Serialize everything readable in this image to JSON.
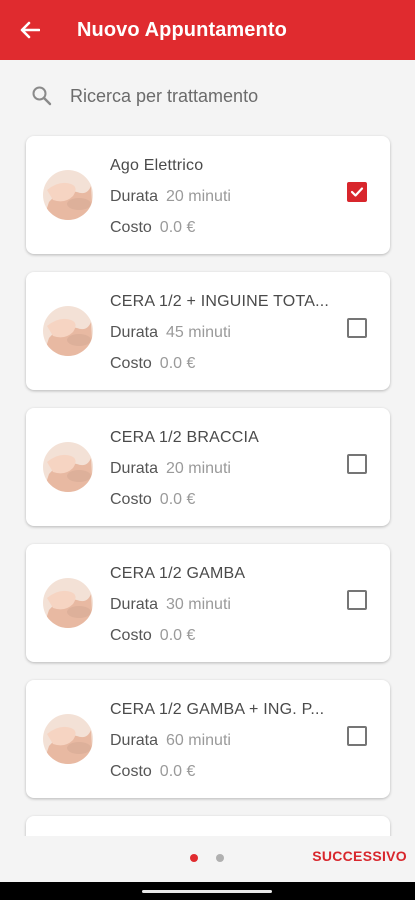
{
  "appbar": {
    "title": "Nuovo Appuntamento",
    "back_icon": "arrow-left-icon",
    "color": "#e02b2f"
  },
  "search": {
    "placeholder": "Ricerca per trattamento",
    "icon": "search-icon"
  },
  "labels": {
    "durata": "Durata",
    "costo": "Costo"
  },
  "treatments": [
    {
      "name": "Ago Elettrico",
      "durata": "20 minuti",
      "costo": "0.0 €",
      "checked": true
    },
    {
      "name": "CERA 1/2 + INGUINE TOTA...",
      "durata": "45 minuti",
      "costo": "0.0 €",
      "checked": false
    },
    {
      "name": "CERA 1/2 BRACCIA",
      "durata": "20 minuti",
      "costo": "0.0 €",
      "checked": false
    },
    {
      "name": "CERA 1/2 GAMBA",
      "durata": "30 minuti",
      "costo": "0.0 €",
      "checked": false
    },
    {
      "name": "CERA 1/2 GAMBA + ING. P...",
      "durata": "60 minuti",
      "costo": "0.0 €",
      "checked": false
    }
  ],
  "pager": {
    "pages": 2,
    "current": 1
  },
  "footer": {
    "next_label": "SUCCESSIVO"
  }
}
